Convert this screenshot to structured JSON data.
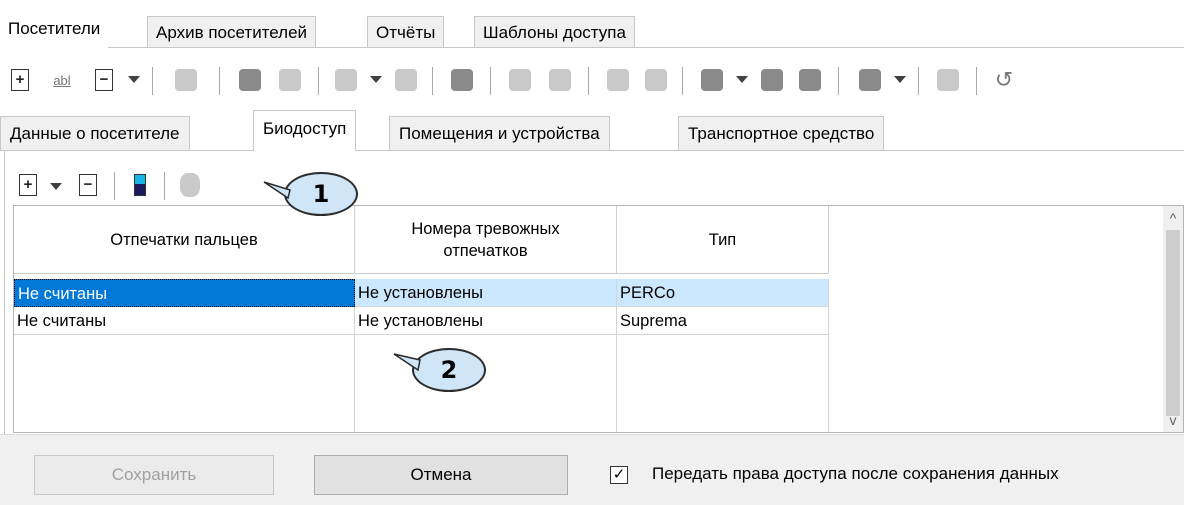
{
  "top_tabs": [
    "Посетители",
    "Архив посетителей",
    "Отчёты",
    "Шаблоны доступа"
  ],
  "sub_tabs": [
    "Данные о посетителе",
    "Биодоступ",
    "Помещения и устройства",
    "Транспортное средство"
  ],
  "grid": {
    "headers": [
      "Отпечатки пальцев",
      "Номера тревожных отпечатков",
      "Тип"
    ],
    "rows": [
      [
        "Не считаны",
        "Не установлены",
        "PERCo"
      ],
      [
        "Не считаны",
        "Не установлены",
        "Suprema"
      ]
    ],
    "selected_row": 0
  },
  "buttons": {
    "save": "Сохранить",
    "cancel": "Отмена"
  },
  "checkbox": {
    "label": "Передать права доступа после сохранения данных",
    "checked": true,
    "mark": "✓"
  },
  "callouts": [
    "1",
    "2"
  ],
  "toolbar": {
    "abl_icon_text": "abl",
    "plus_glyph": "+",
    "minus_glyph": "−",
    "undo_glyph": "↺"
  },
  "scroll": {
    "up": "^",
    "down": "v"
  },
  "colors": {
    "selection": "#0078d7",
    "row_highlight": "#cce8ff",
    "callout_fill": "#cfe6f8"
  }
}
